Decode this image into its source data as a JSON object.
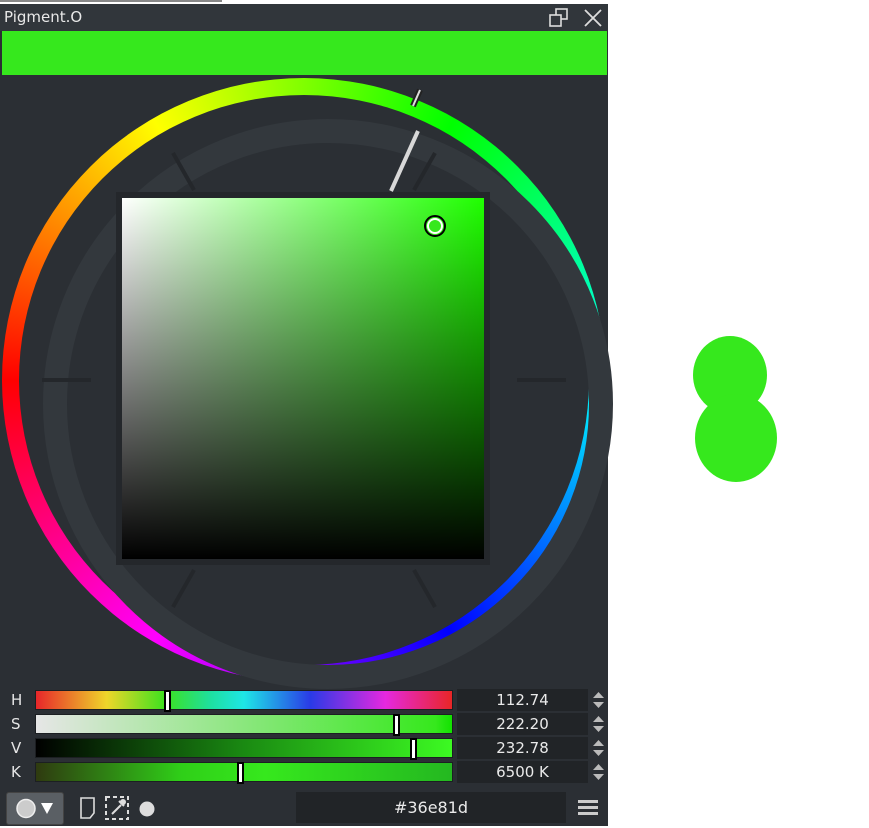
{
  "window": {
    "title": "Pigment.O",
    "float_icon": "float-window-icon",
    "close_icon": "close-icon"
  },
  "colors": {
    "current": "#36e81d",
    "accent_hue": 112.74
  },
  "sliders": [
    {
      "label": "H",
      "value": "112.74",
      "fraction": 0.313
    },
    {
      "label": "S",
      "value": "222.20",
      "fraction": 0.871
    },
    {
      "label": "V",
      "value": "232.78",
      "fraction": 0.913
    },
    {
      "label": "K",
      "value": "6500 K",
      "fraction": 0.49
    }
  ],
  "bottom": {
    "hex": "#36e81d",
    "shape_icon": "circle-dropdown-icon",
    "note_icon": "note-icon",
    "picker_icon": "eyedropper-icon",
    "dot_icon": "circle-icon",
    "menu_icon": "hamburger-menu-icon"
  }
}
